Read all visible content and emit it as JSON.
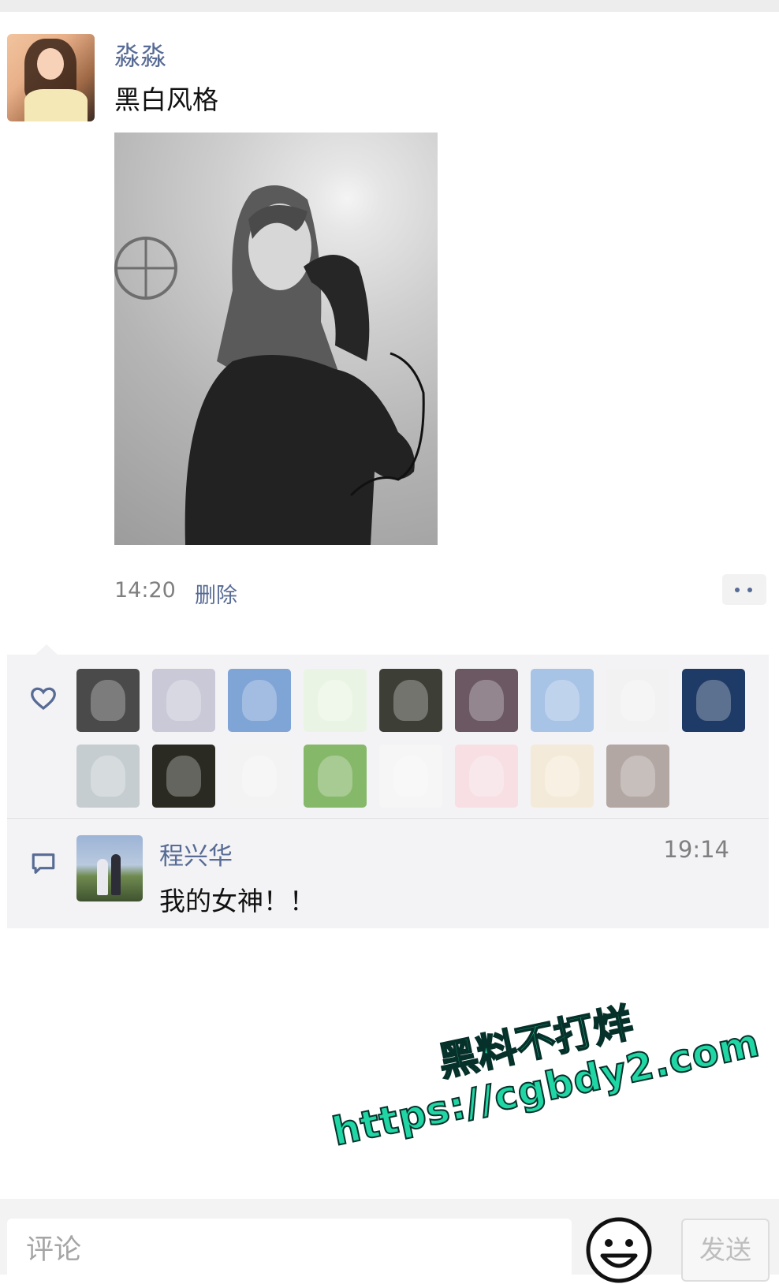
{
  "post": {
    "author": "淼淼",
    "text": "黑白风格",
    "time": "14:20",
    "delete_label": "删除",
    "more_icon": "more-dots-icon"
  },
  "likes": {
    "icon": "heart-icon",
    "avatars": [
      {
        "name": "like-avatar-stormtrooper",
        "bg": "#4a4a4a"
      },
      {
        "name": "like-avatar-anime-silver-hair",
        "bg": "#c9c9d8"
      },
      {
        "name": "like-avatar-blue-sky",
        "bg": "#7fa4d6"
      },
      {
        "name": "like-avatar-green-hair-chibi",
        "bg": "#eaf4e4"
      },
      {
        "name": "like-avatar-headphones-boy",
        "bg": "#3d3f36"
      },
      {
        "name": "like-avatar-flower-girl",
        "bg": "#6b5863"
      },
      {
        "name": "like-avatar-anime-scenery",
        "bg": "#a7c3e6"
      },
      {
        "name": "like-avatar-panda-meme",
        "bg": "#f2f2f2"
      },
      {
        "name": "like-avatar-night-anime",
        "bg": "#1e3a66"
      },
      {
        "name": "like-avatar-owl",
        "bg": "#c6cdd1"
      },
      {
        "name": "like-avatar-dark-character",
        "bg": "#2a2a22"
      },
      {
        "name": "like-avatar-black-hair-chibi",
        "bg": "#f3f3f3"
      },
      {
        "name": "like-avatar-green-dinosaur",
        "bg": "#86b86a"
      },
      {
        "name": "like-avatar-sketch-boy",
        "bg": "#f6f6f6"
      },
      {
        "name": "like-avatar-red-hair-anime",
        "bg": "#f7dfe4"
      },
      {
        "name": "like-avatar-blonde-anime",
        "bg": "#f4ead9"
      },
      {
        "name": "like-avatar-drawn-girl",
        "bg": "#b2a7a2"
      }
    ]
  },
  "comments": {
    "icon": "comment-icon",
    "items": [
      {
        "name": "程兴华",
        "text": "我的女神！！",
        "time": "19:14"
      }
    ]
  },
  "watermark": {
    "line1": "黑料不打烊",
    "line2": "https://cgbdy2.com"
  },
  "input": {
    "placeholder": "评论",
    "send_label": "发送",
    "emoji_icon": "smiley-icon"
  }
}
